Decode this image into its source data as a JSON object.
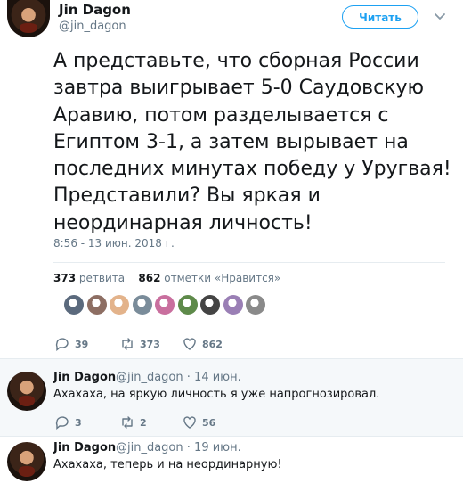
{
  "tweet": {
    "author_name": "Jin Dagon",
    "author_handle": "@jin_dagon",
    "follow_label": "Читать",
    "text": "А представьте, что сборная России\nзавтра выигрывает 5-0 Саудовскую\nАравию, потом разделывается с\nЕгиптом 3-1, а затем вырывает на\nпоследних минутах победу у Уругвая!\nПредставили? Вы яркая и\nнеординарная личность!",
    "timestamp": "8:56 - 13 июн. 2018 г.",
    "retweets_count": "373",
    "retweets_label": "ретвита",
    "likes_count": "862",
    "likes_label": "отметки «Нравится»",
    "actions": {
      "replies": "39",
      "retweets": "373",
      "likes": "862"
    },
    "liker_colors": [
      "#5b6a7d",
      "#8d6e63",
      "#e3b38b",
      "#7a8c9a",
      "#c96f9e",
      "#5e8a4a",
      "#444444",
      "#9a7fb5",
      "#8a8a8a"
    ]
  },
  "replies": [
    {
      "author_name": "Jin Dagon",
      "author_handle": "@jin_dagon",
      "date": "· 14 июн.",
      "text": "Ахахаха, на яркую личность я уже напрогнозировал.",
      "actions": {
        "replies": "3",
        "retweets": "2",
        "likes": "56"
      }
    },
    {
      "author_name": "Jin Dagon",
      "author_handle": "@jin_dagon",
      "date": "· 19 июн.",
      "text": "Ахахаха, теперь и на неординарную!"
    }
  ]
}
